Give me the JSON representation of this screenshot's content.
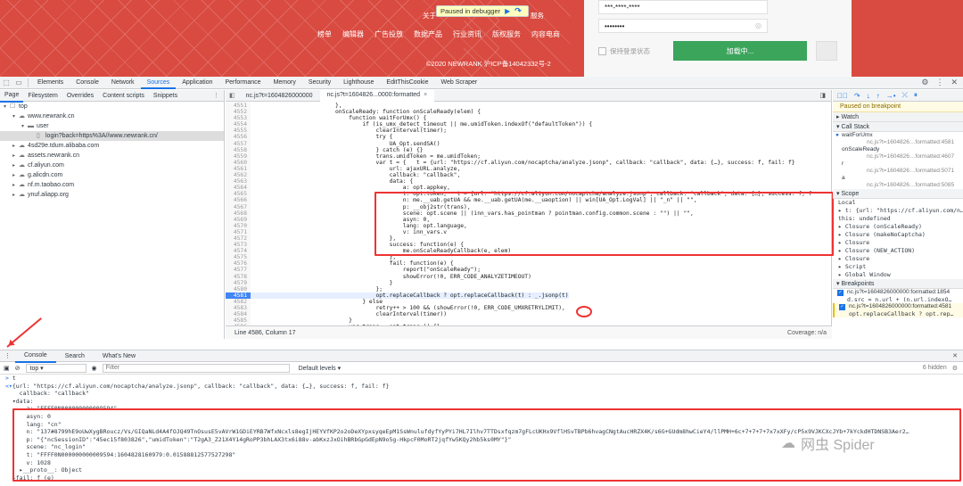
{
  "webpage": {
    "top_links": [
      "关于",
      "Paused in debugger",
      "服务"
    ],
    "nav": [
      "榜单",
      "编辑器",
      "广告投放",
      "数据产品",
      "行业资讯",
      "版权服务",
      "内容电商"
    ],
    "copyright": "©2020 NEWRANK 沪ICP备14042332号-2",
    "debug_banner": "Paused in debugger",
    "login": {
      "username_value": "***-****-****",
      "password_value": "••••••••",
      "remember_label": "保持登录状态",
      "button_label": "加载中..."
    }
  },
  "devtools": {
    "main_tabs": [
      "Elements",
      "Console",
      "Network",
      "Sources",
      "Application",
      "Performance",
      "Memory",
      "Security",
      "Lighthouse",
      "EditThisCookie",
      "Web Scraper"
    ],
    "active_tab": "Sources",
    "navigator": {
      "subtabs": [
        "Page",
        "Filesystem",
        "Overrides",
        "Content scripts",
        "Snippets"
      ],
      "tree": [
        {
          "label": "top",
          "depth": 0,
          "arrow": "▾",
          "icon": "☐"
        },
        {
          "label": "www.newrank.cn",
          "depth": 1,
          "arrow": "▾",
          "icon": "☁"
        },
        {
          "label": "user",
          "depth": 2,
          "arrow": "▾",
          "icon": "▬"
        },
        {
          "label": "login?back=https%3A//www.newrank.cn/",
          "depth": 3,
          "arrow": "",
          "icon": "▯",
          "selected": true
        },
        {
          "label": "4sd29e.tdum.alibaba.com",
          "depth": 1,
          "arrow": "▸",
          "icon": "☁"
        },
        {
          "label": "assets.newrank.cn",
          "depth": 1,
          "arrow": "▸",
          "icon": "☁"
        },
        {
          "label": "cf.aliyun.com",
          "depth": 1,
          "arrow": "▸",
          "icon": "☁"
        },
        {
          "label": "g.alicdn.com",
          "depth": 1,
          "arrow": "▸",
          "icon": "☁"
        },
        {
          "label": "nf.m.taobao.com",
          "depth": 1,
          "arrow": "▸",
          "icon": "☁"
        },
        {
          "label": "ynuf.aliapp.org",
          "depth": 1,
          "arrow": "▸",
          "icon": "☁"
        }
      ]
    },
    "editor": {
      "tabs": [
        "nc.js?t=1604826000000",
        "nc.js?t=1604826...0000:formatted"
      ],
      "status_left": "Line 4586, Column 17",
      "status_right": "Coverage: n/a",
      "lines": [
        {
          "n": "4551",
          "t": "                        },"
        },
        {
          "n": "4552",
          "t": "                        onScaleReady: function onScaleReady(elem) {"
        },
        {
          "n": "4553",
          "t": "                            function waitForUmx() {"
        },
        {
          "n": "4554",
          "t": "                                if (is_umx_detect_timeout || me.umidToken.indexOf(\"defaultToken\")) {"
        },
        {
          "n": "4555",
          "t": "                                    clearInterval(timer);"
        },
        {
          "n": "4556",
          "t": "                                    try {"
        },
        {
          "n": "4557",
          "t": "                                        UA_Opt.sendSA()"
        },
        {
          "n": "4558",
          "t": "                                    } catch (e) {}"
        },
        {
          "n": "4559",
          "t": "                                    trans.umidToken = me.umidToken;"
        },
        {
          "n": "4560",
          "t": "                                    var t = {   t = {url: \"https://cf.aliyun.com/nocaptcha/analyze.jsonp\", callback: \"callback\", data: {…}, success: f, fail: f}"
        },
        {
          "n": "4561",
          "t": "                                        url: ajaxURL.analyze,"
        },
        {
          "n": "4562",
          "t": "                                        callback: \"callback\","
        },
        {
          "n": "4563",
          "t": "                                        data: {"
        },
        {
          "n": "4564",
          "t": "                                            a: opt.appkey,"
        },
        {
          "n": "4565",
          "t": "                                            t: opt.token,   t = {url: \"https://cf.aliyun.com/nocaptcha/analyze.jsonp\", callback: \"callback\", data: {…}, success: f, f"
        },
        {
          "n": "4566",
          "t": "                                            n: me.__uab.getUA && me.__uab.getUA(me.__uaoption) || win[UA_Opt.LogVal] || \"_n\" || \"\","
        },
        {
          "n": "4567",
          "t": "                                            p: __obj2str(trans),"
        },
        {
          "n": "4568",
          "t": "                                            scene: opt.scene || (inn_vars.has_pointman ? pointman.config.common.scene : \"\") || \"\","
        },
        {
          "n": "4569",
          "t": "                                            asyn: 0,"
        },
        {
          "n": "4570",
          "t": "                                            lang: opt.language,"
        },
        {
          "n": "4571",
          "t": "                                            v: inn_vars.v"
        },
        {
          "n": "4572",
          "t": "                                        },"
        },
        {
          "n": "4573",
          "t": "                                        success: function(e) {"
        },
        {
          "n": "4574",
          "t": "                                            me.onScaleReadyCallback(e, elem)"
        },
        {
          "n": "4575",
          "t": "                                        },"
        },
        {
          "n": "4576",
          "t": "                                        fail: function(e) {"
        },
        {
          "n": "4577",
          "t": "                                            report(\"onScaleReady\");"
        },
        {
          "n": "4578",
          "t": "                                            showError(!0, ERR_CODE_ANALYZETIMEOUT)"
        },
        {
          "n": "4579",
          "t": "                                        }"
        },
        {
          "n": "4580",
          "t": "                                    };"
        },
        {
          "n": "4581",
          "t": "                                    opt.replaceCallback ? opt.replaceCallback(t) : _.jsonp(t)",
          "bp": true
        },
        {
          "n": "4582",
          "t": "                                } else"
        },
        {
          "n": "4583",
          "t": "                                    retry++ > 100 && (showError(!0, ERR_CODE_UMXRETRYLIMIT),"
        },
        {
          "n": "4584",
          "t": "                                    clearInterval(timer))"
        },
        {
          "n": "4585",
          "t": "                            }"
        },
        {
          "n": "4586",
          "t": "                            var trans = opt.trans || {};"
        }
      ]
    },
    "sidebar": {
      "paused": "Paused on breakpoint",
      "watch": "Watch",
      "call_stack": "Call Stack",
      "frames": [
        {
          "name": "waitForUmx",
          "loc": "nc.js?t=1604826…formatted:4581",
          "current": true
        },
        {
          "name": "onScaleReady",
          "loc": "nc.js?t=1604826…formatted:4607"
        },
        {
          "name": "r",
          "loc": "nc.js?t=1604826…formatted:5071"
        },
        {
          "name": "a",
          "loc": "nc.js?t=1604826…formatted:5085"
        }
      ],
      "scope": "Scope",
      "scope_rows": [
        "Local",
        "▸ t: {url: \"https://cf.aliyun.com/n…",
        "  this: undefined",
        "▸ Closure (onScaleReady)",
        "▸ Closure (makeNoCaptcha)",
        "▸ Closure",
        "▸ Closure (NEW_ACTION)",
        "▸ Closure",
        "▸ Script",
        "▸ Global                  Window"
      ],
      "breakpoints": "Breakpoints",
      "bp_items": [
        {
          "file": "nc.js?t=1604826000000:formatted:1854",
          "code": "d.src = n.url + (n.url.indexO…"
        },
        {
          "file": "nc.js?t=1604826000000:formatted:4581",
          "code": "opt.replaceCallback ? opt.rep…",
          "active": true
        }
      ]
    },
    "console": {
      "tabs": [
        "Console",
        "Search",
        "What's New"
      ],
      "context": "top",
      "filter_placeholder": "Filter",
      "levels": "Default levels ▾",
      "hidden": "6 hidden",
      "lines": [
        {
          "kind": "input",
          "text": "t"
        },
        {
          "kind": "out",
          "text": "{url: \"https://cf.aliyun.com/nocaptcha/analyze.jsonp\", callback: \"callback\", data: {…}, success: f, fail: f}"
        },
        {
          "kind": "prop",
          "text": "    callback: \"callback\""
        },
        {
          "kind": "prop",
          "text": "  ▾data:"
        },
        {
          "kind": "prop",
          "text": "      a: \"FFFF0N000000000009594\""
        },
        {
          "kind": "prop",
          "text": "      asyn: 0"
        },
        {
          "kind": "prop",
          "text": "      lang: \"cn\""
        },
        {
          "kind": "prop",
          "text": "      n: \"137#8799hE9oUwXygBRoucz/Vs/GIQaNLd4A4fOJQ49TnOsusE5vAVrW1GDiEYRB7WfxNcxls8egIjHEYVfKP2o2oDeXYpxsyqeEpM1SsWnulufdyfYyPYi7HL7Ilhv7TTDsxfqzm7gFLcUKHx9VflHSvTBPb6hvagCNgtAucHRZX4K/s6G+GUdm8hwCieY4/llPMH+6c+7+7+7+7x7xXFy/cP5x9VJKCXcJYb+7kYckdHTDNSB3Aer2…"
        },
        {
          "kind": "prop",
          "text": "      p: \"{\"ncSessionID\":\"45ec15f803826\",\"umidToken\":\"T2gA3_Z21X4Y14gRoPP3bhLAX3tx6i88v-abKxzJxOihBRbGpGdEpN9o5g-HkpcF0MoRT2jqfYw5KQy2hb5ks0MY\"}\""
        },
        {
          "kind": "prop",
          "text": "      scene: \"nc_login\""
        },
        {
          "kind": "prop",
          "text": "      t: \"FFFF0N000000000009594:1604828160979:0.01588812577527298\""
        },
        {
          "kind": "prop",
          "text": "      v: 1028"
        },
        {
          "kind": "prop",
          "text": "    ▸__proto__: Object"
        },
        {
          "kind": "prop",
          "text": "  ▸fail: f (e)"
        }
      ]
    },
    "watermark": "网虫 Spider"
  }
}
